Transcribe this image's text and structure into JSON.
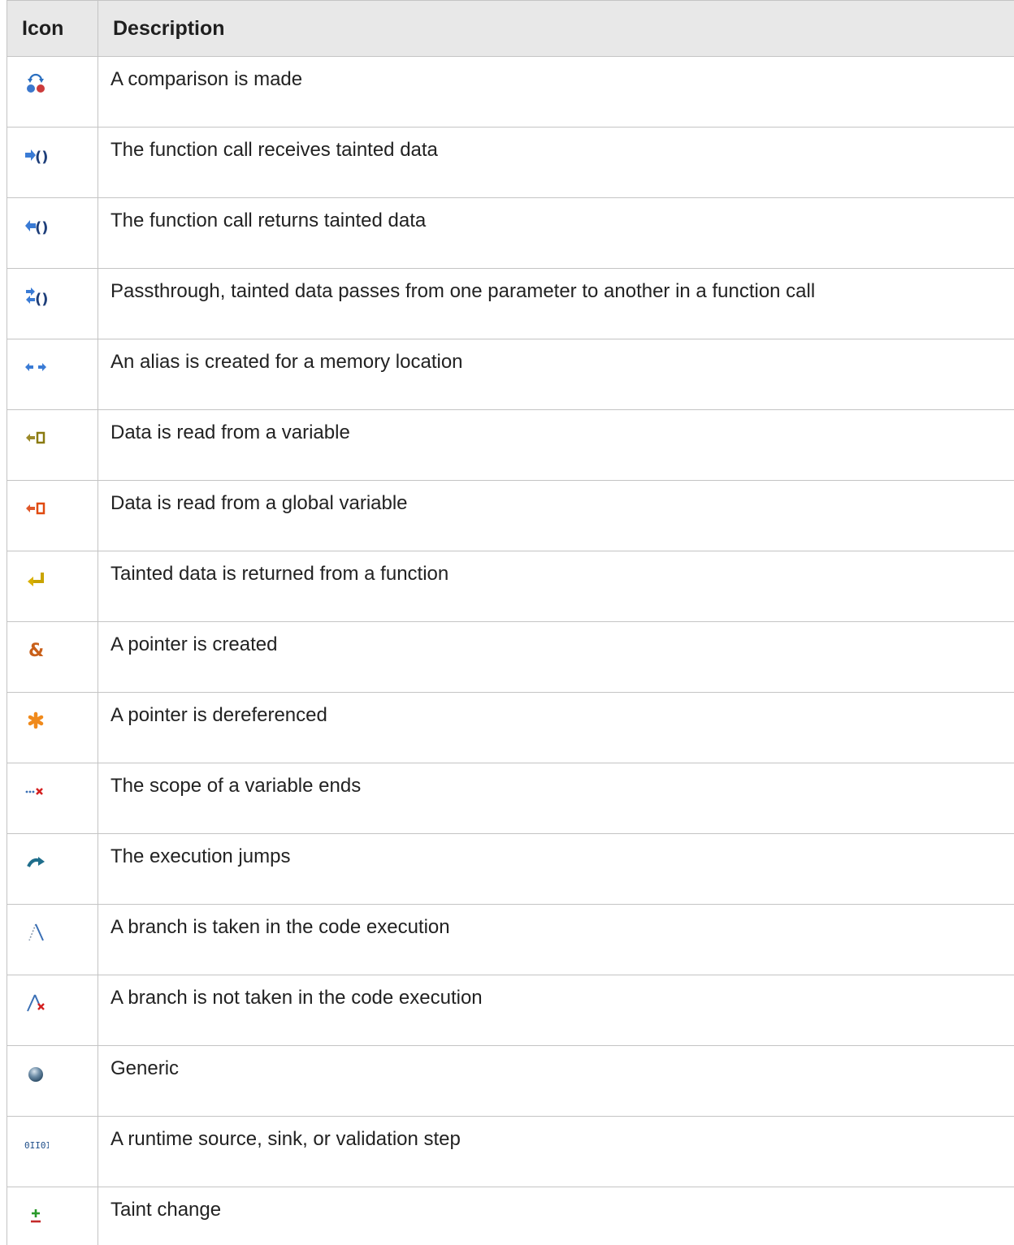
{
  "header": {
    "icon": "Icon",
    "description": "Description"
  },
  "rows": [
    {
      "icon": "comparison-icon",
      "description": "A comparison is made"
    },
    {
      "icon": "function-receives-icon",
      "description": "The function call receives tainted data"
    },
    {
      "icon": "function-returns-icon",
      "description": "The function call returns tainted data"
    },
    {
      "icon": "passthrough-icon",
      "description": "Passthrough, tainted data passes from one parameter to another in a function call"
    },
    {
      "icon": "alias-icon",
      "description": "An alias is created for a memory location"
    },
    {
      "icon": "read-variable-icon",
      "description": "Data is read from a variable"
    },
    {
      "icon": "read-global-variable-icon",
      "description": "Data is read from a global variable"
    },
    {
      "icon": "return-from-function-icon",
      "description": "Tainted data is returned from a function"
    },
    {
      "icon": "pointer-created-icon",
      "description": "A pointer is created"
    },
    {
      "icon": "pointer-dereferenced-icon",
      "description": "A pointer is dereferenced"
    },
    {
      "icon": "scope-ends-icon",
      "description": "The scope of a variable ends"
    },
    {
      "icon": "execution-jumps-icon",
      "description": "The execution jumps"
    },
    {
      "icon": "branch-taken-icon",
      "description": "A branch is taken in the code execution"
    },
    {
      "icon": "branch-not-taken-icon",
      "description": "A branch is not taken in the code execution"
    },
    {
      "icon": "generic-icon",
      "description": "Generic"
    },
    {
      "icon": "runtime-icon",
      "description": "A runtime source, sink, or validation step",
      "glyph": "0II0I"
    },
    {
      "icon": "taint-change-icon",
      "description": "Taint change"
    }
  ]
}
